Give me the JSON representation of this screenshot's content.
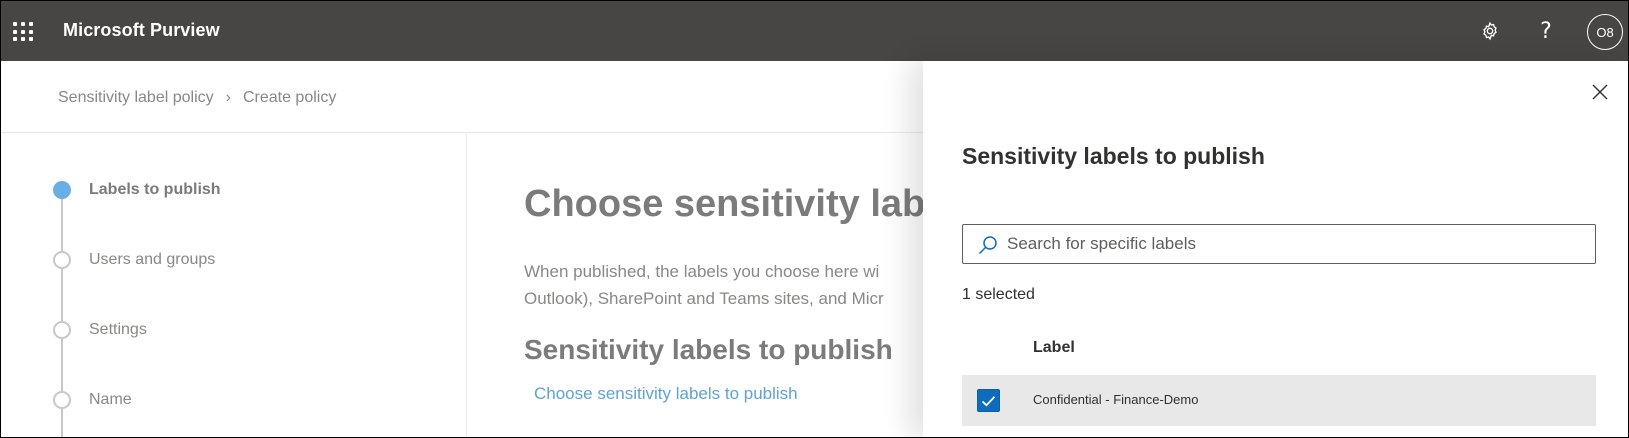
{
  "app": {
    "title": "Microsoft Purview",
    "avatar_initials": "O8",
    "icons": [
      "waffle-icon",
      "gear-icon",
      "help-icon"
    ]
  },
  "breadcrumb": {
    "items": [
      "Sensitivity label policy",
      "Create policy"
    ]
  },
  "steps": [
    {
      "label": "Labels to publish",
      "state": "active"
    },
    {
      "label": "Users and groups",
      "state": "pending"
    },
    {
      "label": "Settings",
      "state": "pending"
    },
    {
      "label": "Name",
      "state": "pending"
    }
  ],
  "main": {
    "heading": "Choose sensitivity labe",
    "description": "When published, the labels you choose here wi Outlook), SharePoint and Teams sites, and Micr",
    "subheading": "Sensitivity labels to publish",
    "link": "Choose sensitivity labels to publish"
  },
  "panel": {
    "title": "Sensitivity labels to publish",
    "search_placeholder": "Search for specific labels",
    "search_value": "",
    "selected_count": "1 selected",
    "column_header": "Label",
    "rows": [
      {
        "label": "Confidential - Finance-Demo",
        "checked": true
      }
    ]
  },
  "colors": {
    "topbar": "#484644",
    "accent": "#0f6cbd",
    "step_active": "#6aaee6",
    "link": "#5ea3d8"
  }
}
